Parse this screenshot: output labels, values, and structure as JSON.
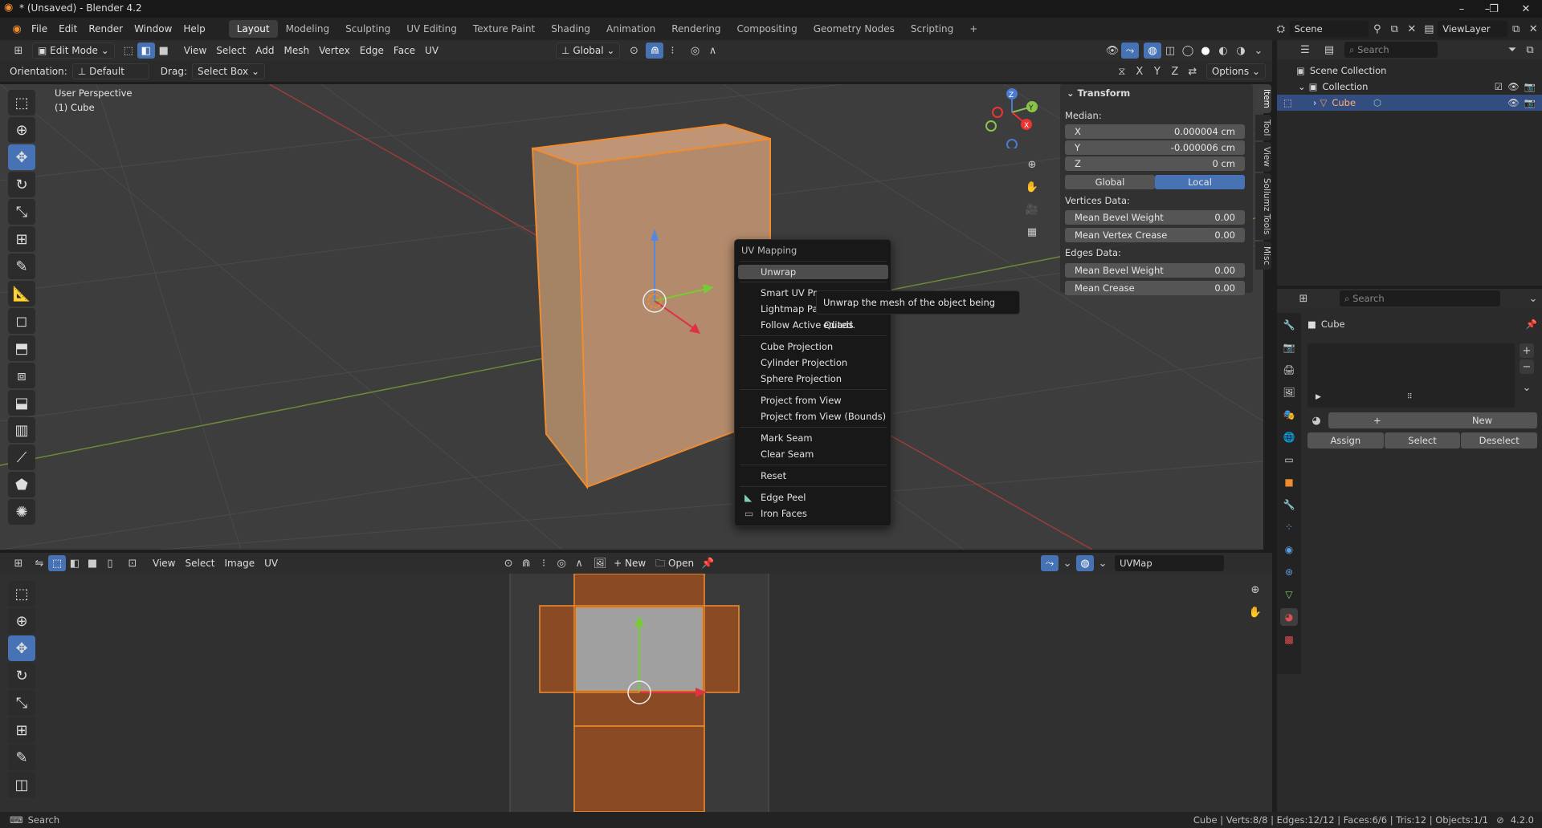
{
  "titlebar": {
    "title": "* (Unsaved) - Blender 4.2",
    "minimize": "–",
    "maximize": "❐",
    "close": "✕"
  },
  "menus": [
    "File",
    "Edit",
    "Render",
    "Window",
    "Help"
  ],
  "workspaces": [
    "Layout",
    "Modeling",
    "Sculpting",
    "UV Editing",
    "Texture Paint",
    "Shading",
    "Animation",
    "Rendering",
    "Compositing",
    "Geometry Nodes",
    "Scripting"
  ],
  "workspace_add": "+",
  "scene": {
    "label": "Scene",
    "viewlayer": "ViewLayer"
  },
  "header3d": {
    "mode": "Edit Mode",
    "menus": [
      "View",
      "Select",
      "Add",
      "Mesh",
      "Vertex",
      "Edge",
      "Face",
      "UV"
    ],
    "transform_orientation": "Global",
    "orientation_label": "Orientation:",
    "orientation_value": "Default",
    "drag_label": "Drag:",
    "drag_value": "Select Box",
    "axes": [
      "X",
      "Y",
      "Z"
    ],
    "options": "Options"
  },
  "viewport": {
    "perspective": "User Perspective",
    "object": "(1) Cube",
    "gizmo_x": "X",
    "gizmo_y": "Y",
    "gizmo_z": "Z"
  },
  "npanel": {
    "section": "Transform",
    "median": "Median:",
    "x_label": "X",
    "x_value": "0.000004 cm",
    "y_label": "Y",
    "y_value": "-0.000006 cm",
    "z_label": "Z",
    "z_value": "0 cm",
    "global": "Global",
    "local": "Local",
    "vertices_data": "Vertices Data:",
    "mean_bevel_weight": "Mean Bevel Weight",
    "mbw_value": "0.00",
    "mean_vertex_crease": "Mean Vertex Crease",
    "mvc_value": "0.00",
    "edges_data": "Edges Data:",
    "edge_mean_bevel_weight": "Mean Bevel Weight",
    "embw_value": "0.00",
    "mean_crease": "Mean Crease",
    "mc_value": "0.00"
  },
  "sidetabs": [
    "Item",
    "Tool",
    "View",
    "Sollumz Tools",
    "Misc"
  ],
  "uv_menu": {
    "title": "UV Mapping",
    "items": [
      "Unwrap",
      "Smart UV Pr",
      "Lightmap Pa",
      "Follow Active Quads",
      "Cube Projection",
      "Cylinder Projection",
      "Sphere Projection",
      "Project from View",
      "Project from View (Bounds)",
      "Mark Seam",
      "Clear Seam",
      "Reset",
      "Edge Peel",
      "Iron Faces"
    ],
    "tooltip": "Unwrap the mesh of the object being edited."
  },
  "uv_header": {
    "menus": [
      "View",
      "Select",
      "Image",
      "UV"
    ],
    "new": "New",
    "open": "Open",
    "uvmap": "UVMap"
  },
  "outliner": {
    "search_placeholder": "Search",
    "scene_collection": "Scene Collection",
    "collection": "Collection",
    "cube": "Cube"
  },
  "properties": {
    "search_placeholder": "Search",
    "object": "Cube",
    "new": "New",
    "assign": "Assign",
    "select": "Select",
    "deselect": "Deselect"
  },
  "statusbar": {
    "search": "Search",
    "stats": "Cube | Verts:8/8 | Edges:12/12 | Faces:6/6 | Tris:12 | Objects:1/1",
    "version": "4.2.0"
  },
  "colors": {
    "accent": "#4772b3",
    "selection": "#f08c2e",
    "face": "#b08868"
  }
}
